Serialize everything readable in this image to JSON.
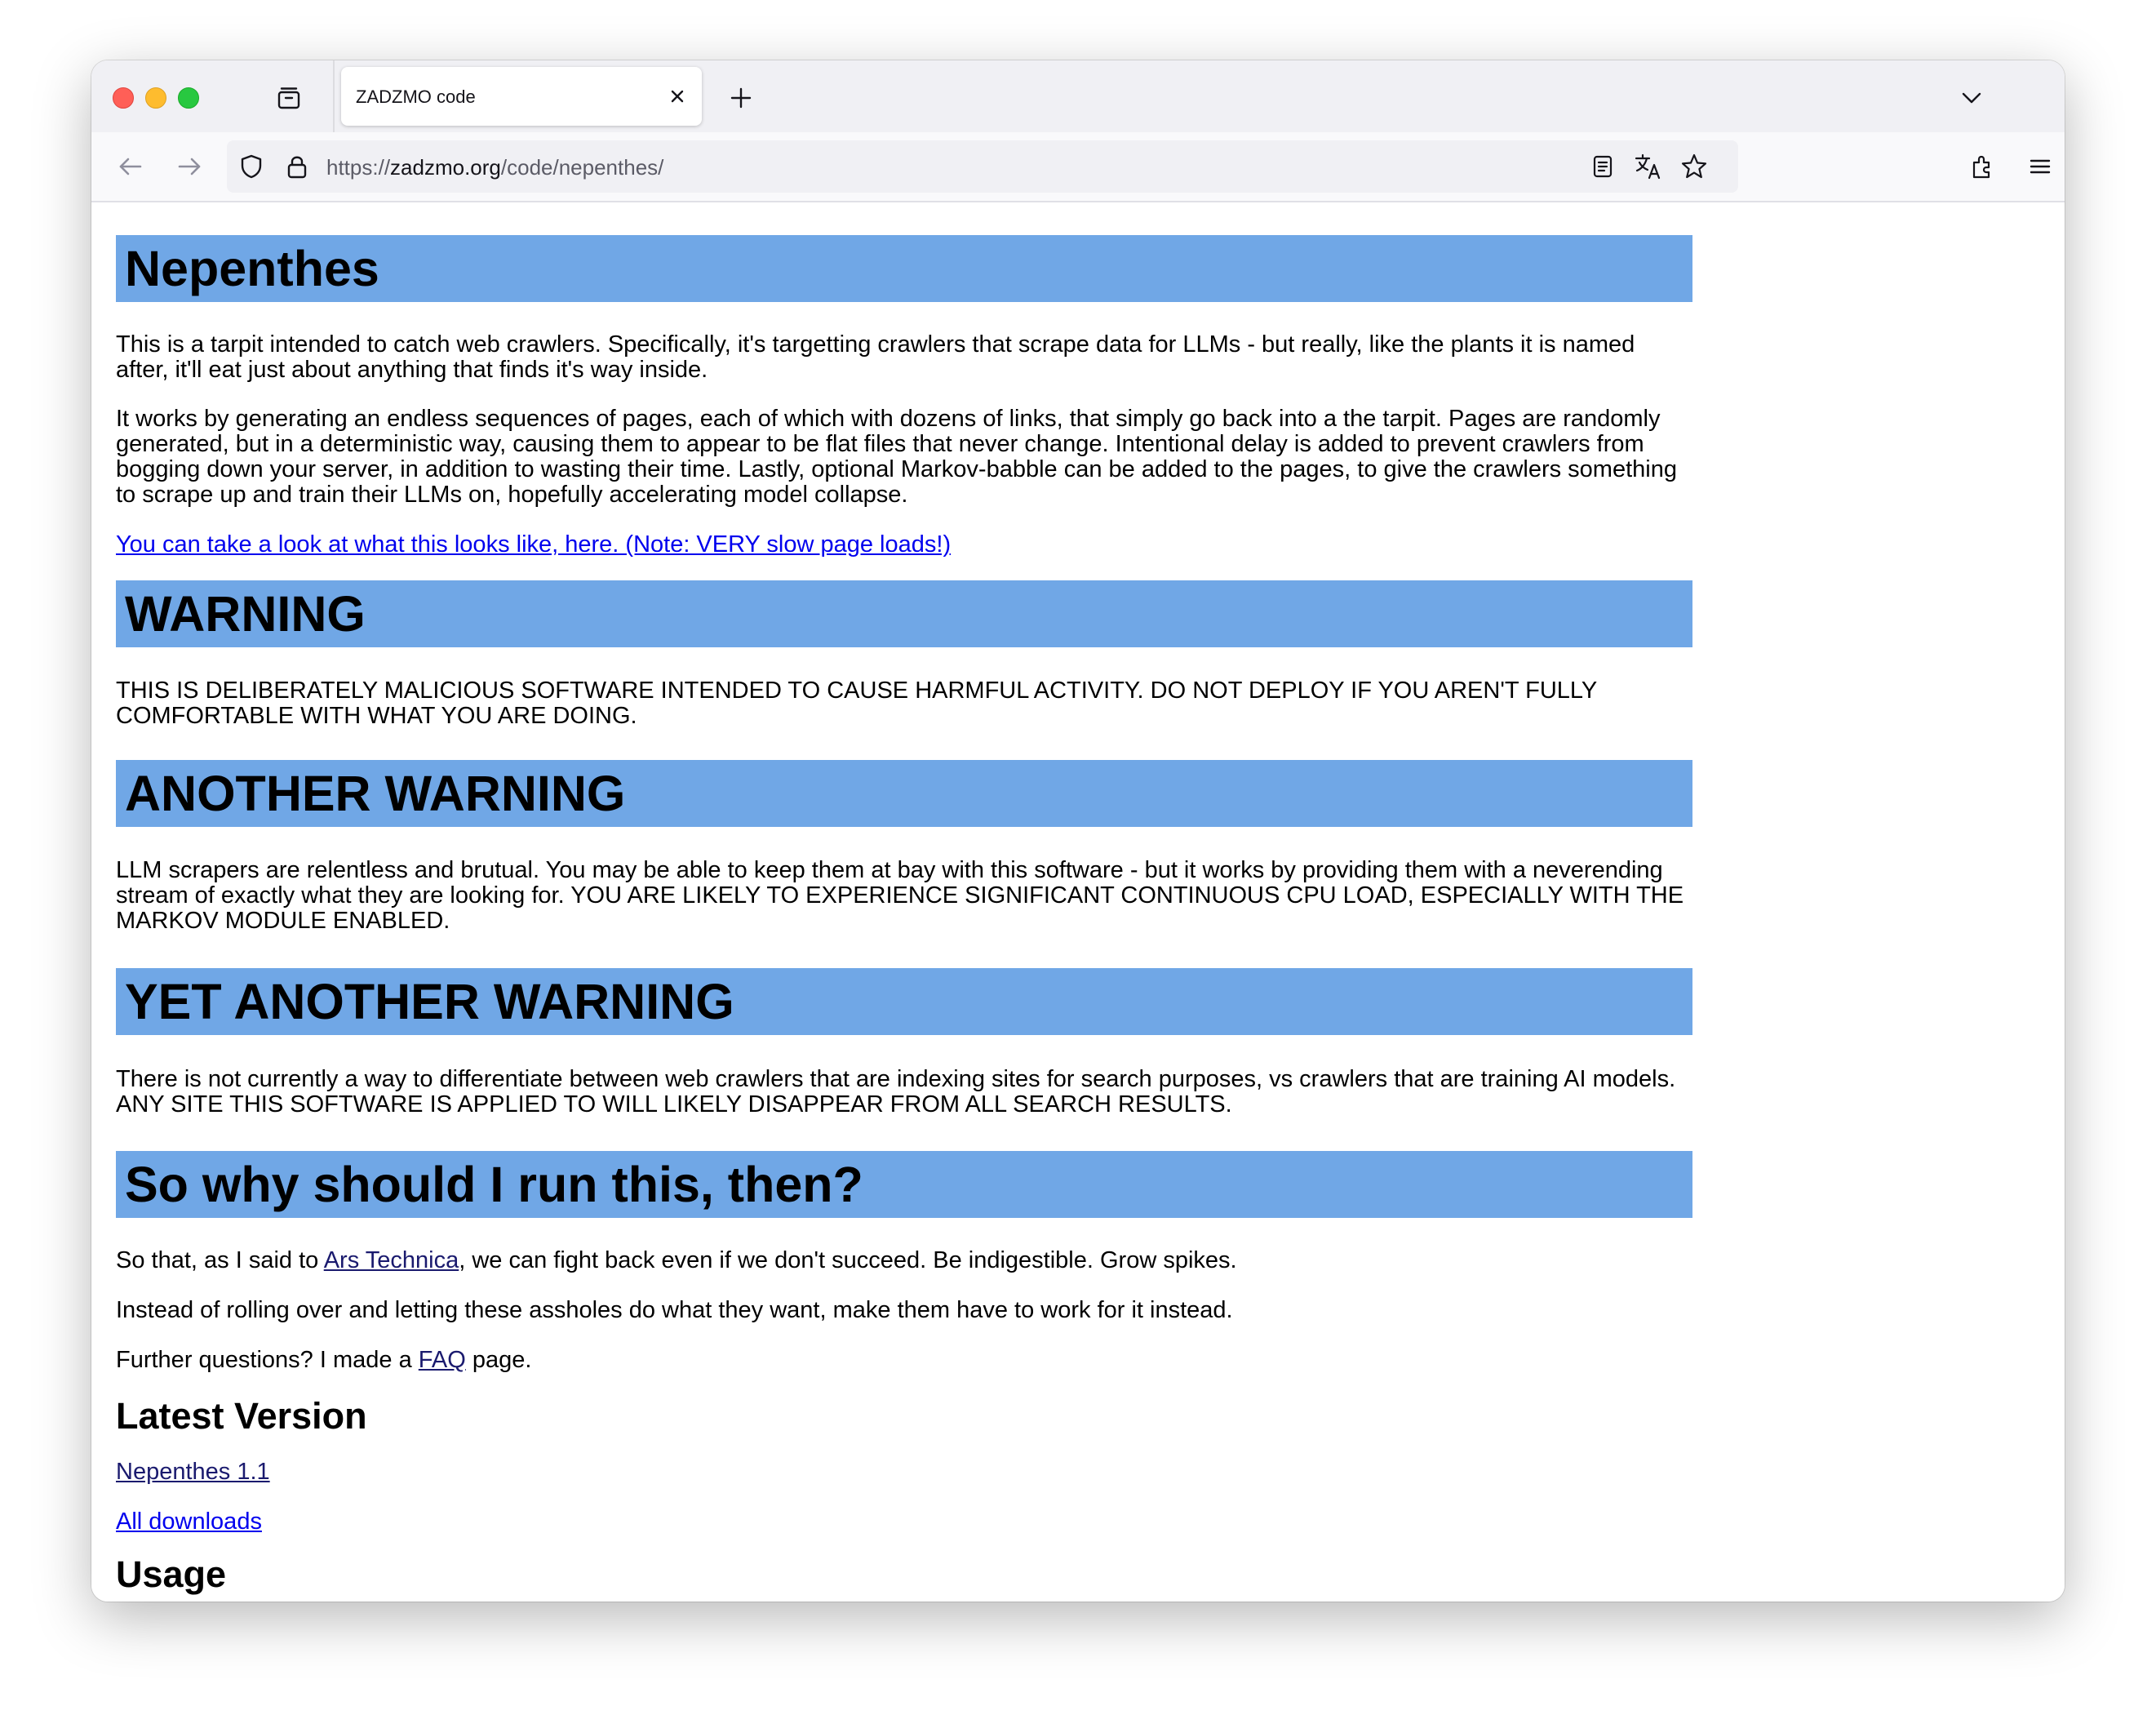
{
  "browser": {
    "tab_title": "ZADZMO code",
    "url_scheme": "https://",
    "url_host": "zadzmo.org",
    "url_path": "/code/nepenthes/",
    "icons": [
      "tab-view-icon",
      "close-icon",
      "plus-icon",
      "chevron-down-icon",
      "back-arrow-icon",
      "forward-arrow-icon",
      "shield-icon",
      "lock-icon",
      "reader-view-icon",
      "translate-icon",
      "star-icon",
      "extensions-icon",
      "hamburger-menu-icon"
    ]
  },
  "page": {
    "heading_bar_color": "#70a7e6",
    "title": "Nepenthes",
    "intro_p1": "This is a tarpit intended to catch web crawlers. Specifically, it's targetting crawlers that scrape data for LLMs - but really, like the plants it is named after, it'll eat just about anything that finds it's way inside.",
    "intro_p2": "It works by generating an endless sequences of pages, each of which with dozens of links, that simply go back into a the tarpit. Pages are randomly generated, but in a deterministic way, causing them to appear to be flat files that never change. Intentional delay is added to prevent crawlers from bogging down your server, in addition to wasting their time. Lastly, optional Markov-babble can be added to the pages, to give the crawlers something to scrape up and train their LLMs on, hopefully accelerating model collapse.",
    "demo_link": "You can take a look at what this looks like, here. (Note: VERY slow page loads!)",
    "warning_heading": "WARNING",
    "warning_text": "THIS IS DELIBERATELY MALICIOUS SOFTWARE INTENDED TO CAUSE HARMFUL ACTIVITY. DO NOT DEPLOY IF YOU AREN'T FULLY COMFORTABLE WITH WHAT YOU ARE DOING.",
    "another_warning_heading": "ANOTHER WARNING",
    "another_warning_text": "LLM scrapers are relentless and brutual. You may be able to keep them at bay with this software - but it works by providing them with a neverending stream of exactly what they are looking for. YOU ARE LIKELY TO EXPERIENCE SIGNIFICANT CONTINUOUS CPU LOAD, ESPECIALLY WITH THE MARKOV MODULE ENABLED.",
    "yet_another_warning_heading": "YET ANOTHER WARNING",
    "yet_another_warning_text": "There is not currently a way to differentiate between web crawlers that are indexing sites for search purposes, vs crawlers that are training AI models. ANY SITE THIS SOFTWARE IS APPLIED TO WILL LIKELY DISAPPEAR FROM ALL SEARCH RESULTS.",
    "why_heading": "So why should I run this, then?",
    "why_p1_before": "So that, as I said to ",
    "why_p1_link": "Ars Technica",
    "why_p1_after": ", we can fight back even if we don't succeed. Be indigestible. Grow spikes.",
    "why_p2": "Instead of rolling over and letting these assholes do what they want, make them have to work for it instead.",
    "why_p3_before": "Further questions? I made a ",
    "why_p3_link": "FAQ",
    "why_p3_after": " page.",
    "latest_heading": "Latest Version",
    "latest_link": "Nepenthes 1.1",
    "downloads_link": "All downloads",
    "usage_heading": "Usage"
  }
}
